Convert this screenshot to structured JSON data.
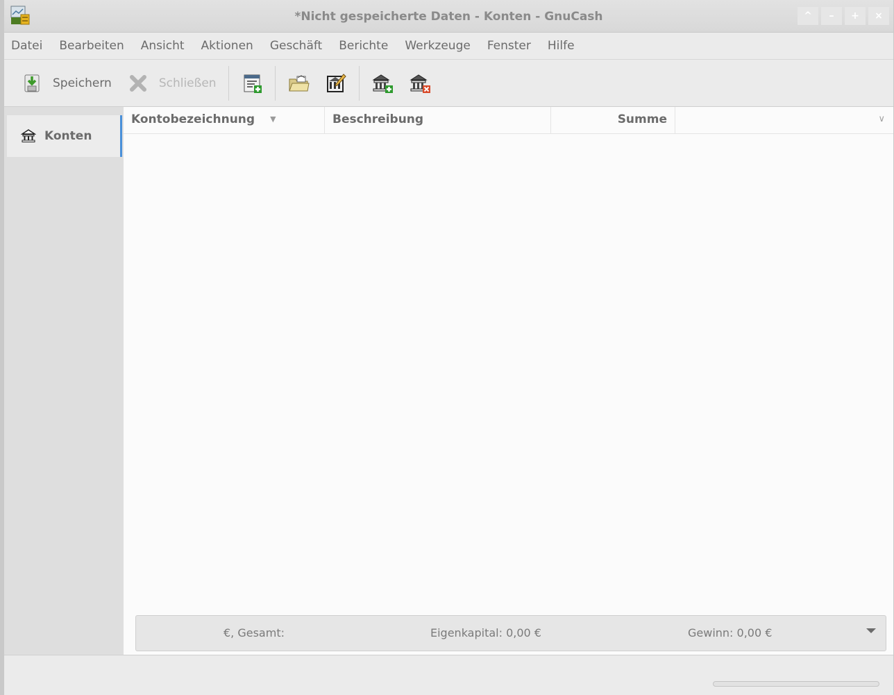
{
  "window": {
    "title": "*Nicht gespeicherte Daten - Konten - GnuCash",
    "controls": [
      "^",
      "–",
      "+",
      "×"
    ]
  },
  "menubar": {
    "items": [
      "Datei",
      "Bearbeiten",
      "Ansicht",
      "Aktionen",
      "Geschäft",
      "Berichte",
      "Werkzeuge",
      "Fenster",
      "Hilfe"
    ]
  },
  "toolbar": {
    "save_label": "Speichern",
    "close_label": "Schließen",
    "icons": [
      "save-icon",
      "close-icon",
      "new-transaction-icon",
      "open-account-icon",
      "edit-account-icon",
      "new-account-icon",
      "delete-account-icon"
    ]
  },
  "tabs": [
    {
      "label": "Konten",
      "icon": "bank-icon",
      "active": true
    }
  ],
  "tree": {
    "columns": [
      "Kontobezeichnung",
      "Beschreibung",
      "Summe"
    ],
    "sort_column": "Kontobezeichnung",
    "rows": []
  },
  "summary": {
    "currency_total": "€, Gesamt:",
    "equity": "Eigenkapital: 0,00 €",
    "profit": "Gewinn: 0,00 €"
  },
  "colors": {
    "active_tab_accent": "#4a90d9"
  }
}
